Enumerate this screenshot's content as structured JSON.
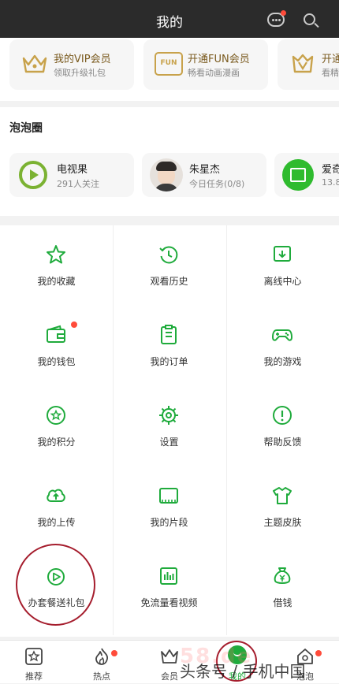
{
  "header": {
    "title": "我的"
  },
  "membership": [
    {
      "icon": "crown-icon",
      "title": "我的VIP会员",
      "sub": "领取升级礼包"
    },
    {
      "icon": "fun-icon",
      "title": "开通FUN会员",
      "sub": "畅看动画漫画"
    },
    {
      "icon": "vip-v-icon",
      "title": "开通",
      "sub": "看精"
    }
  ],
  "bubble_circle": {
    "title": "泡泡圈",
    "items": [
      {
        "name": "电视果",
        "sub": "291人关注"
      },
      {
        "name": "朱星杰",
        "sub": "今日任务(0/8)"
      },
      {
        "name": "爱奇",
        "sub": "13.8"
      }
    ]
  },
  "grid": [
    {
      "label": "我的收藏",
      "icon": "star-icon"
    },
    {
      "label": "观看历史",
      "icon": "history-icon"
    },
    {
      "label": "离线中心",
      "icon": "download-icon"
    },
    {
      "label": "我的钱包",
      "icon": "wallet-icon"
    },
    {
      "label": "我的订单",
      "icon": "order-icon"
    },
    {
      "label": "我的游戏",
      "icon": "gamepad-icon"
    },
    {
      "label": "我的积分",
      "icon": "points-icon"
    },
    {
      "label": "设置",
      "icon": "settings-icon"
    },
    {
      "label": "帮助反馈",
      "icon": "help-icon"
    },
    {
      "label": "我的上传",
      "icon": "upload-icon"
    },
    {
      "label": "我的片段",
      "icon": "clip-icon"
    },
    {
      "label": "主题皮肤",
      "icon": "shirt-icon"
    },
    {
      "label": "办套餐送礼包",
      "icon": "package-play-icon"
    },
    {
      "label": "免流量看视频",
      "icon": "data-free-icon"
    },
    {
      "label": "借钱",
      "icon": "money-bag-icon"
    }
  ],
  "tabs": [
    {
      "label": "推荐",
      "icon": "recommend-icon"
    },
    {
      "label": "热点",
      "icon": "flame-icon"
    },
    {
      "label": "会员",
      "icon": "crown-icon"
    },
    {
      "label": "我的",
      "icon": "mine-icon"
    },
    {
      "label": "泡泡",
      "icon": "bubble-icon"
    }
  ],
  "watermark": {
    "text": "头条号 / 手机中国",
    "site": "58.de"
  },
  "colors": {
    "accent": "#1fab3c",
    "vip_gold": "#c8a24b",
    "badge_red": "#ff4b3a",
    "circle_red": "#a51d2d"
  }
}
